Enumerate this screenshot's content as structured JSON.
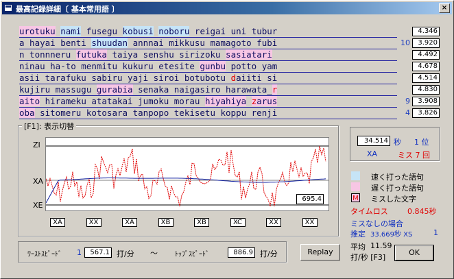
{
  "window": {
    "title": "最高記録詳細〔 基本常用語 〕",
    "close_glyph": "×"
  },
  "rows": [
    {
      "segments": [
        [
          "slow",
          "urotuku"
        ],
        [
          "n",
          " "
        ],
        [
          "fast",
          "nami"
        ],
        [
          "n",
          " fusegu "
        ],
        [
          "fast",
          "kobusi"
        ],
        [
          "n",
          " "
        ],
        [
          "fast",
          "noboru"
        ],
        [
          "n",
          " reigai uni tubur"
        ]
      ],
      "num": "",
      "score": "4.346"
    },
    {
      "segments": [
        [
          "n",
          "a hayai benti "
        ],
        [
          "fast",
          "shuudan"
        ],
        [
          "n",
          " annnai mikkusu mamagoto fubi"
        ]
      ],
      "num": "10",
      "score": "3.920"
    },
    {
      "segments": [
        [
          "n",
          "n tonnneru "
        ],
        [
          "slow",
          "futuka"
        ],
        [
          "n",
          " taiya senshu sirizoku "
        ],
        [
          "slow",
          "sasiatari"
        ]
      ],
      "num": "",
      "score": "4.492"
    },
    {
      "segments": [
        [
          "n",
          "ninau ha-to menmitu kukuru etesite "
        ],
        [
          "slow",
          "gunbu"
        ],
        [
          "n",
          " potto yam"
        ]
      ],
      "num": "",
      "score": "4.678"
    },
    {
      "segments": [
        [
          "n",
          "asii tarafuku sabiru yaji siroi botubotu "
        ],
        [
          "miss",
          "d"
        ],
        [
          "n",
          "aiiti si"
        ]
      ],
      "num": "",
      "score": "4.514"
    },
    {
      "segments": [
        [
          "n",
          "kujiru massugu "
        ],
        [
          "slow",
          "gurabia"
        ],
        [
          "n",
          " senaka naigasiro harawata_"
        ],
        [
          "missslow",
          "r"
        ]
      ],
      "num": "",
      "score": "4.830"
    },
    {
      "segments": [
        [
          "slow",
          "aito"
        ],
        [
          "n",
          " hirameku atatakai jumoku morau "
        ],
        [
          "slow",
          "hiyahiya"
        ],
        [
          "n",
          " "
        ],
        [
          "slowmiss",
          "z"
        ],
        [
          "slow",
          "arus"
        ]
      ],
      "num": "9",
      "score": "3.908"
    },
    {
      "segments": [
        [
          "slow",
          "oba"
        ],
        [
          "n",
          " sitomeru kotosara tanpopo tekisetu koppu renji"
        ]
      ],
      "num": "4",
      "score": "3.826"
    }
  ],
  "graph": {
    "label": "[F1]: 表示切替",
    "axis_top": "ZI",
    "axis_mid": "XA",
    "axis_bottom": "XE",
    "value_box": "695.4",
    "buttons": [
      "XA",
      "XX",
      "XA",
      "XB",
      "XB",
      "XC",
      "XX",
      "XX"
    ]
  },
  "result": {
    "time_value": "34.514",
    "time_unit": "秒",
    "rank": "1 位",
    "rank_label": "XA",
    "miss_text": "ミス 7 回"
  },
  "legend": {
    "fast_label": "速く打った語句",
    "slow_label": "遅く打った語句",
    "miss_glyph": "M",
    "miss_label": "ミスした文字",
    "fast_color": "#c6e4f7",
    "slow_color": "#f7c6e4"
  },
  "stats": {
    "timeloss_label": "タイムロス",
    "timeloss_value": "0.845秒",
    "nomiss_label": "ミスなしの場合",
    "estimate_label": "推定",
    "estimate_value": "33.669秒 XS",
    "estimate_rank": "1",
    "avg_label": "平均",
    "avg_value": "11.59",
    "avg_unit": "打/秒 [F3]"
  },
  "speeds": {
    "worst_label": "ﾜｰｽﾄｽﾋﾟｰﾄﾞ",
    "worst_num": "1",
    "worst_value": "567.1",
    "unit1": "打/分",
    "tilde": "〜",
    "top_label": "ﾄｯﾌﾟｽﾋﾟｰﾄﾞ",
    "top_value": "886.9",
    "unit2": "打/分"
  },
  "buttons": {
    "replay": "Replay",
    "ok": "OK"
  }
}
